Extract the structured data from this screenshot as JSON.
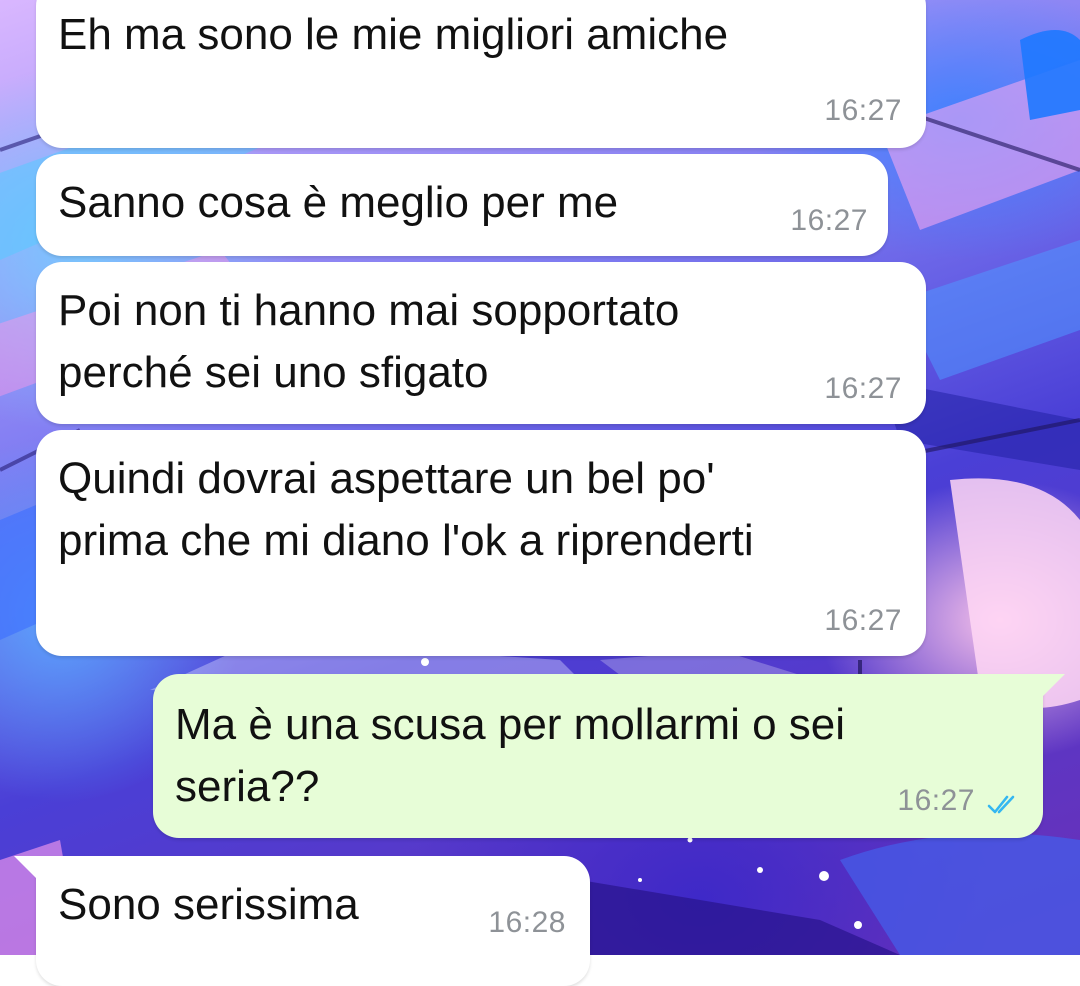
{
  "messages": [
    {
      "text": "Eh ma sono le mie migliori amiche",
      "time": "16:27",
      "direction": "incoming"
    },
    {
      "text": "Sanno cosa è meglio per me",
      "time": "16:27",
      "direction": "incoming"
    },
    {
      "text": "Poi non ti hanno mai sopportato\nperché sei uno sfigato",
      "time": "16:27",
      "direction": "incoming"
    },
    {
      "text": "Quindi dovrai aspettare un bel po'\nprima che mi diano l'ok a riprenderti",
      "time": "16:27",
      "direction": "incoming"
    },
    {
      "text": "Ma è una scusa per mollarmi o sei\nseria??",
      "time": "16:27",
      "direction": "outgoing",
      "status_icon": "double-check-read-icon"
    },
    {
      "text": "Sono serissima",
      "time": "16:28",
      "direction": "incoming"
    }
  ],
  "colors": {
    "incoming_bubble": "#ffffff",
    "outgoing_bubble": "#e7fdd7",
    "timestamp": "#8e9297",
    "read_ticks": "#34b7f1"
  }
}
